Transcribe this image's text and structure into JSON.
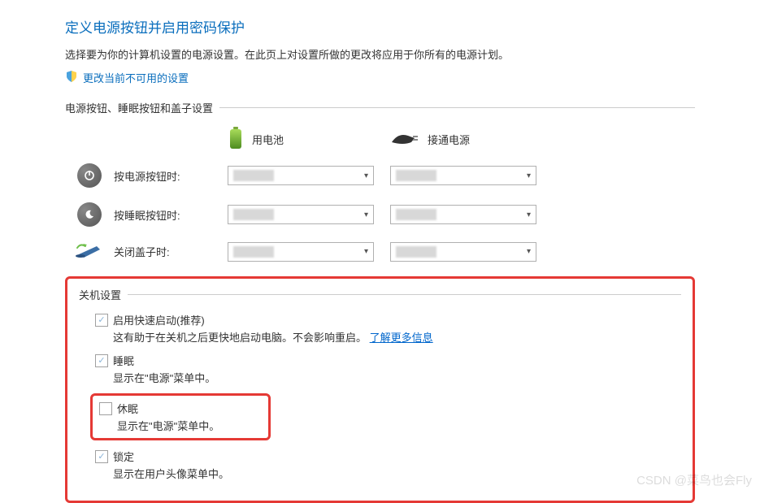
{
  "header": {
    "title": "定义电源按钮并启用密码保护",
    "description": "选择要为你的计算机设置的电源设置。在此页上对设置所做的更改将应用于你所有的电源计划。",
    "admin_link": "更改当前不可用的设置"
  },
  "buttons_section": {
    "title": "电源按钮、睡眠按钮和盖子设置",
    "col_battery": "用电池",
    "col_plugged": "接通电源",
    "rows": {
      "power": "按电源按钮时:",
      "sleep": "按睡眠按钮时:",
      "lid": "关闭盖子时:"
    }
  },
  "shutdown_section": {
    "title": "关机设置",
    "fast_startup": {
      "label": "启用快速启动(推荐)",
      "desc": "这有助于在关机之后更快地启动电脑。不会影响重启。",
      "link": "了解更多信息"
    },
    "sleep": {
      "label": "睡眠",
      "desc": "显示在\"电源\"菜单中。"
    },
    "hibernate": {
      "label": "休眠",
      "desc": "显示在\"电源\"菜单中。"
    },
    "lock": {
      "label": "锁定",
      "desc": "显示在用户头像菜单中。"
    }
  },
  "watermark": "CSDN @菜鸟也会Fly"
}
